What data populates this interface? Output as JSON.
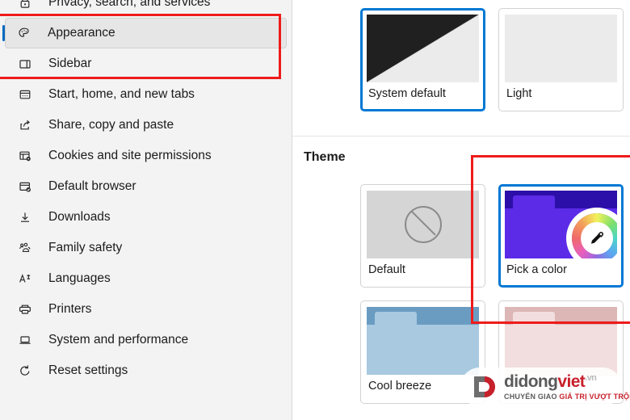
{
  "sidebar": {
    "items": [
      {
        "label": "Privacy, search, and services",
        "icon": "lock-shield-icon",
        "selected": false
      },
      {
        "label": "Appearance",
        "icon": "palette-icon",
        "selected": true
      },
      {
        "label": "Sidebar",
        "icon": "sidebar-panel-icon",
        "selected": false
      },
      {
        "label": "Start, home, and new tabs",
        "icon": "new-tab-page-icon",
        "selected": false
      },
      {
        "label": "Share, copy and paste",
        "icon": "share-icon",
        "selected": false
      },
      {
        "label": "Cookies and site permissions",
        "icon": "cookies-permissions-icon",
        "selected": false
      },
      {
        "label": "Default browser",
        "icon": "default-browser-check-icon",
        "selected": false
      },
      {
        "label": "Downloads",
        "icon": "download-arrow-icon",
        "selected": false
      },
      {
        "label": "Family safety",
        "icon": "family-people-icon",
        "selected": false
      },
      {
        "label": "Languages",
        "icon": "languages-letter-icon",
        "selected": false
      },
      {
        "label": "Printers",
        "icon": "printer-icon",
        "selected": false
      },
      {
        "label": "System and performance",
        "icon": "laptop-icon",
        "selected": false
      },
      {
        "label": "Reset settings",
        "icon": "reset-arrow-icon",
        "selected": false
      }
    ]
  },
  "main": {
    "mode_cards": [
      {
        "label": "System default",
        "preview": "split-dark-light",
        "selected": true
      },
      {
        "label": "Light",
        "preview": "light-plain",
        "selected": false
      }
    ],
    "theme_section_title": "Theme",
    "theme_cards": [
      {
        "label": "Default",
        "preview": "none",
        "selected": false,
        "topbar_color": "",
        "body_color": "",
        "tab_color": ""
      },
      {
        "label": "Pick a color",
        "preview": "color",
        "selected": true,
        "topbar_color": "#2c0fa8",
        "body_color": "#5b2be8",
        "tab_color": "#5b2be8",
        "badge": "eyedropper-icon"
      },
      {
        "label": "Cool breeze",
        "preview": "color",
        "selected": false,
        "topbar_color": "#6a9cc2",
        "body_color": "#a8c9e0",
        "tab_color": "#a8c9e0"
      },
      {
        "label": "",
        "preview": "color",
        "selected": false,
        "topbar_color": "#ddb6b6",
        "body_color": "#f2dede",
        "tab_color": "#f2dede"
      }
    ]
  },
  "annotations": {
    "color": "#ee1b1b",
    "boxes": [
      {
        "name": "sidebar-appearance-highlight"
      },
      {
        "name": "theme-pick-a-color-highlight"
      }
    ]
  },
  "watermark": {
    "title_part1": "didong",
    "title_part2": "viet",
    "title_tld": ".vn",
    "subtitle_part1": "CHUYỂN GIAO ",
    "subtitle_part2": "GIÁ TRỊ VƯỢT TRỘI"
  }
}
